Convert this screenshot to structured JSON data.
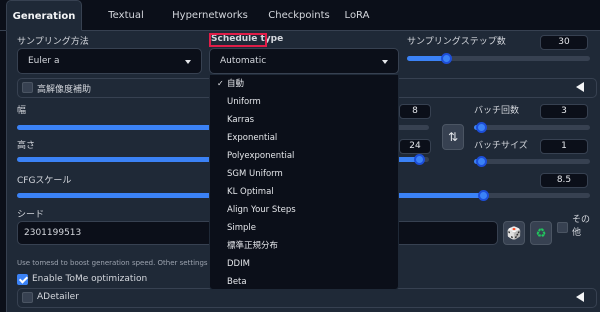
{
  "tabs": [
    "Generation",
    "Textual Inversion",
    "Hypernetworks",
    "Checkpoints",
    "LoRA"
  ],
  "sampler": {
    "label": "サンプリング方法",
    "value": "Euler a"
  },
  "schedule": {
    "label": "Schedule type",
    "value": "Automatic",
    "options": [
      "自動",
      "Uniform",
      "Karras",
      "Exponential",
      "Polyexponential",
      "SGM Uniform",
      "KL Optimal",
      "Align Your Steps",
      "Simple",
      "標準正規分布",
      "DDIM",
      "Beta"
    ],
    "selected_index": 0
  },
  "steps": {
    "label": "サンプリングステップ数",
    "value": "30",
    "fraction": 0.2
  },
  "hires": {
    "label": "高解像度補助",
    "checked": false
  },
  "width": {
    "label": "幅",
    "value": "8",
    "fraction": 0.7
  },
  "height": {
    "label": "高さ",
    "value": "24",
    "fraction": 0.99
  },
  "batch_count": {
    "label": "バッチ回数",
    "value": "3",
    "fraction": 0.02
  },
  "batch_size": {
    "label": "バッチサイズ",
    "value": "1",
    "fraction": 0.02
  },
  "cfg": {
    "label": "CFGスケール",
    "value": "8.5",
    "fraction": 0.82
  },
  "swap_icon": "⇅",
  "seed": {
    "label": "シード",
    "value": "2301199513",
    "dice_icon": "🎲",
    "recycle_icon": "♻"
  },
  "extra": {
    "label_line1": "その",
    "label_line2": "他"
  },
  "tome": {
    "hint": "Use tomesd to boost generation speed. Other settings in Setti",
    "label": "Enable ToMe optimization",
    "checked": true
  },
  "adetailer": {
    "label": "ADetailer",
    "checked": false
  },
  "colors": {
    "accent": "#3b82f6",
    "highlight": "#e11d48"
  }
}
